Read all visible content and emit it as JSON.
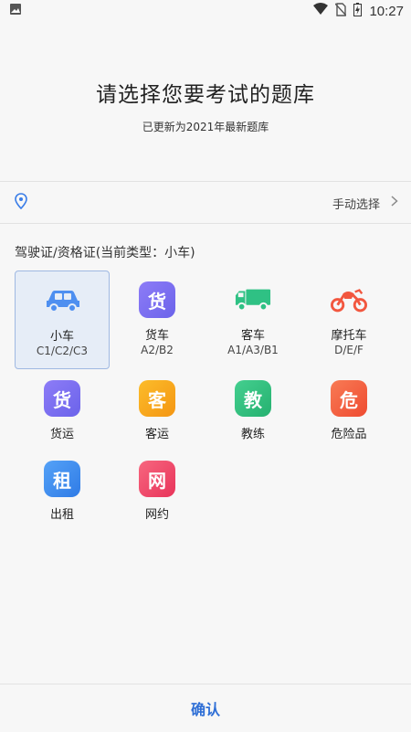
{
  "status_bar": {
    "time": "10:27",
    "icons": [
      "image-icon",
      "wifi-icon",
      "no-sim-icon",
      "battery-charging-icon"
    ]
  },
  "header": {
    "title": "请选择您要考试的题库",
    "subtitle": "已更新为2021年最新题库"
  },
  "location": {
    "icon": "location-pin-icon",
    "action_label": "手动选择"
  },
  "section_title": "驾驶证/资格证(当前类型：小车)",
  "categories": [
    {
      "label": "小车",
      "sub": "C1/C2/C3",
      "icon": "car-icon",
      "color": "#4e8ff0",
      "selected": true
    },
    {
      "label": "货车",
      "sub": "A2/B2",
      "icon": "huo-badge",
      "badge_text": "货",
      "color": "#7b6ff0"
    },
    {
      "label": "客车",
      "sub": "A1/A3/B1",
      "icon": "truck-icon",
      "color": "#2fc184"
    },
    {
      "label": "摩托车",
      "sub": "D/E/F",
      "icon": "motorcycle-icon",
      "color": "#f2573f"
    },
    {
      "label": "货运",
      "icon": "huo-badge",
      "badge_text": "货",
      "color": "#7b6ff0"
    },
    {
      "label": "客运",
      "icon": "ke-badge",
      "badge_text": "客",
      "color": "#f7a21a"
    },
    {
      "label": "教练",
      "icon": "jiao-badge",
      "badge_text": "教",
      "color": "#31bd7f"
    },
    {
      "label": "危险品",
      "icon": "wei-badge",
      "badge_text": "危",
      "color": "#f4623f"
    },
    {
      "label": "出租",
      "icon": "zu-badge",
      "badge_text": "租",
      "color": "#3f8eee"
    },
    {
      "label": "网约",
      "icon": "wang-badge",
      "badge_text": "网",
      "color": "#ef4a6a"
    }
  ],
  "confirm_label": "确认",
  "colors": {
    "accent": "#2f6fd6",
    "selected_bg": "#e6edf7",
    "selected_border": "#9fb8e2"
  }
}
